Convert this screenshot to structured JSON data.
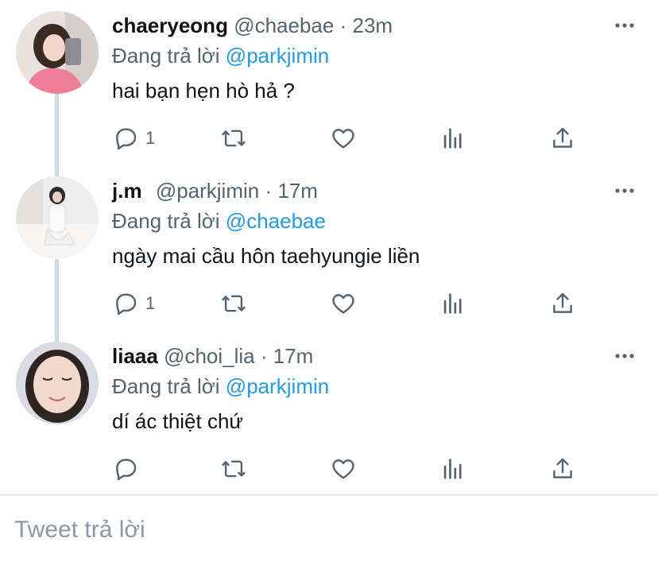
{
  "replying_prefix": "Đang trả lời",
  "tweets": [
    {
      "name": "chaeryeong",
      "handle": "@chaebae",
      "separator": "·",
      "time": "23m",
      "replying_to": "@parkjimin",
      "text": "hai bạn hẹn hò hả ?",
      "reply_count": "1"
    },
    {
      "name": "j.m",
      "handle": "@parkjimin",
      "separator": "·",
      "time": "17m",
      "replying_to": "@chaebae",
      "text": "ngày mai cầu hôn taehyungie liền",
      "reply_count": "1"
    },
    {
      "name": "liaaa",
      "handle": "@choi_lia",
      "separator": "·",
      "time": "17m",
      "replying_to": "@parkjimin",
      "text": "dí ác thiệt chứ",
      "reply_count": ""
    }
  ],
  "composer": {
    "placeholder": "Tweet trả lời"
  },
  "colors": {
    "accent": "#1d9bf0",
    "secondary_text": "#536471",
    "thread_line": "#cfd9de"
  },
  "icons": {
    "reply": "comment-icon",
    "retweet": "retweet-icon",
    "like": "heart-icon",
    "analytics": "analytics-icon",
    "share": "share-icon",
    "more": "more-icon"
  }
}
